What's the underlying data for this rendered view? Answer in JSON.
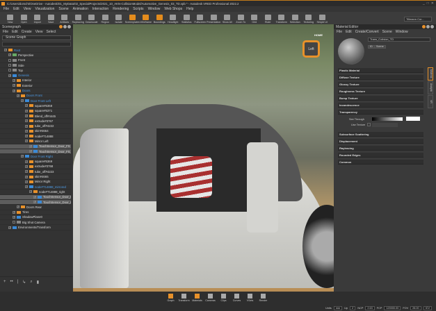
{
  "title": "C:/Users/dorscht/OneDrive - Autodesk/01_MyData/02_SpecialProjects/2021_10_AKN-CollisionModel/Automotive_Genesis_03_TD.vpb * - Autodesk VRED Professional 2022.2",
  "menu": [
    "File",
    "Edit",
    "View",
    "Visualization",
    "Scene",
    "Animation",
    "Interaction",
    "Rendering",
    "Scripts",
    "Window",
    "Web Shops",
    "Help"
  ],
  "toolbar": [
    {
      "label": "New",
      "icon": "new-file-icon"
    },
    {
      "label": "Open",
      "icon": "open-folder-icon"
    },
    {
      "label": "Import",
      "icon": "import-icon"
    },
    {
      "label": "Save",
      "icon": "save-icon"
    },
    {
      "label": "Artifacts",
      "icon": "artifacts-icon"
    },
    {
      "label": "Raytracing",
      "icon": "raytracing-icon"
    },
    {
      "label": "Downscale",
      "icon": "downscale-icon"
    },
    {
      "label": "Region",
      "icon": "region-icon"
    },
    {
      "label": "Isolate",
      "icon": "isolate-icon"
    },
    {
      "label": "Screenplates",
      "icon": "screenplates-icon",
      "active": true
    },
    {
      "label": "Wireframe",
      "icon": "wireframe-icon",
      "active": true
    },
    {
      "label": "Boundings",
      "icon": "boundings-icon",
      "active": true
    },
    {
      "label": "Headlight",
      "icon": "headlight-icon"
    },
    {
      "label": "Statistics",
      "icon": "statistics-icon"
    },
    {
      "label": "Fullscreen",
      "icon": "fullscreen-icon"
    },
    {
      "label": "Presentation",
      "icon": "presentation-icon"
    },
    {
      "label": "Show All",
      "icon": "show-all-icon"
    },
    {
      "label": "Zoom To",
      "icon": "zoom-to-icon"
    },
    {
      "label": "Grid",
      "icon": "grid-icon"
    },
    {
      "label": "Ruler",
      "icon": "ruler-icon"
    },
    {
      "label": "Transform",
      "icon": "transform-icon"
    },
    {
      "label": "Selection",
      "icon": "selection-icon"
    },
    {
      "label": "Texturing",
      "icon": "texturing-icon"
    },
    {
      "label": "Simple UI",
      "icon": "simple-ui-icon"
    }
  ],
  "camera_select": "Tillmann Cor...",
  "scenegraph": {
    "title": "Scenegraph",
    "menu": [
      "File",
      "Edit",
      "Create",
      "View",
      "Select"
    ],
    "mode": "Scene Graph",
    "items": [
      {
        "label": "Root",
        "level": 0,
        "type": "group",
        "blue": true
      },
      {
        "label": "Perspective",
        "level": 1,
        "type": "cam"
      },
      {
        "label": "Front",
        "level": 1,
        "type": "gray",
        "unchecked": true
      },
      {
        "label": "Side",
        "level": 1,
        "type": "gray",
        "unchecked": true
      },
      {
        "label": "Top",
        "level": 1,
        "type": "gray",
        "unchecked": true
      },
      {
        "label": "Genesis",
        "level": 1,
        "type": "blue",
        "blue": true
      },
      {
        "label": "Interior",
        "level": 2,
        "type": "group"
      },
      {
        "label": "Exterior",
        "level": 2,
        "type": "group"
      },
      {
        "label": "Doors",
        "level": 2,
        "type": "group",
        "blue": true
      },
      {
        "label": "Doors Front",
        "level": 3,
        "type": "group",
        "blue": true
      },
      {
        "label": "Door Front Left",
        "level": 4,
        "type": "blue",
        "blue": true
      },
      {
        "label": "square#5368",
        "level": 5,
        "type": "group"
      },
      {
        "label": "square#5371",
        "level": 5,
        "type": "group"
      },
      {
        "label": "Blend_off#4445",
        "level": 5,
        "type": "group"
      },
      {
        "label": "extrude#3767",
        "level": 5,
        "type": "group"
      },
      {
        "label": "tube_off#4222",
        "level": 5,
        "type": "group"
      },
      {
        "label": "skin#4664",
        "level": 5,
        "type": "group"
      },
      {
        "label": "node#T14888",
        "level": 5,
        "type": "group"
      },
      {
        "label": "Mirror Left",
        "level": 5,
        "type": "group"
      },
      {
        "label": "TouchSensor_Door_FS",
        "level": 6,
        "type": "blue",
        "sel": true
      },
      {
        "label": "TouchSensor_Door_FS_int",
        "level": 6,
        "type": "blue",
        "sel": true
      },
      {
        "label": "Door Front Right",
        "level": 4,
        "type": "blue",
        "blue": true
      },
      {
        "label": "square#5369",
        "level": 5,
        "type": "group"
      },
      {
        "label": "extrude#3768",
        "level": 5,
        "type": "group"
      },
      {
        "label": "tube_off#4223",
        "level": 5,
        "type": "group"
      },
      {
        "label": "skin#4665",
        "level": 5,
        "type": "group"
      },
      {
        "label": "Mirror Right",
        "level": 5,
        "type": "group"
      },
      {
        "label": "node#T14888_mirrored",
        "level": 5,
        "type": "blue",
        "blue": true
      },
      {
        "label": "node#T14888_right",
        "level": 6,
        "type": "group"
      },
      {
        "label": "TouchSensor_Door_BFS",
        "level": 7,
        "type": "blue",
        "sel": true
      },
      {
        "label": "TouchSensor_Door_BFL",
        "level": 7,
        "type": "blue",
        "sel": true
      },
      {
        "label": "Doors Rear",
        "level": 3,
        "type": "group"
      },
      {
        "label": "Tires",
        "level": 2,
        "type": "group"
      },
      {
        "label": "ShadowPlane0",
        "level": 2,
        "type": "blue"
      },
      {
        "label": "Big Shot Camera",
        "level": 2,
        "type": "gray",
        "unchecked": true
      },
      {
        "label": "Environments/Transform",
        "level": 1,
        "type": "blue"
      }
    ],
    "footer_icons": [
      "add-icon",
      "link-icon",
      "split-icon",
      "transform-icon",
      "find-icon",
      "delete-icon"
    ]
  },
  "viewport": {
    "navcube_label": "Left",
    "home_label": "HOME"
  },
  "material_editor": {
    "title": "Material Editor",
    "menu": [
      "File",
      "Edit",
      "Create/Convert",
      "Scene",
      "Window"
    ],
    "material_name": "Trans_Colision_TD",
    "btn_id": "ID",
    "btn_scene": "Scene",
    "sections": [
      "Plastic Material",
      "Diffuse Texture",
      "Glossy Texture",
      "Roughness Texture",
      "Bump Texture",
      "Incandescence",
      "Transparency"
    ],
    "see_through_label": "See Through",
    "use_texture_label": "Use Texture",
    "sections2": [
      "Subsurface Scattering",
      "Displacement",
      "Raytracing",
      "Rounded Edges",
      "Common"
    ],
    "tabs": [
      "Material",
      "Analytic",
      "VR"
    ]
  },
  "dock": [
    {
      "label": "Graph",
      "active": true
    },
    {
      "label": "Transform"
    },
    {
      "label": "Materials",
      "active": true
    },
    {
      "label": "Cameras"
    },
    {
      "label": "Clips"
    },
    {
      "label": "Curves"
    },
    {
      "label": "VSets"
    },
    {
      "label": "Render"
    }
  ],
  "status": {
    "units_label": "Units",
    "units": "mm",
    "up_label": "Up",
    "up": "Z",
    "ncp_label": "NCP",
    "ncp": "2.63",
    "fcp_label": "FCP",
    "fcp": "120000.00",
    "fov_label": "FOV",
    "fov": "28.00",
    "icv": "ICV"
  }
}
